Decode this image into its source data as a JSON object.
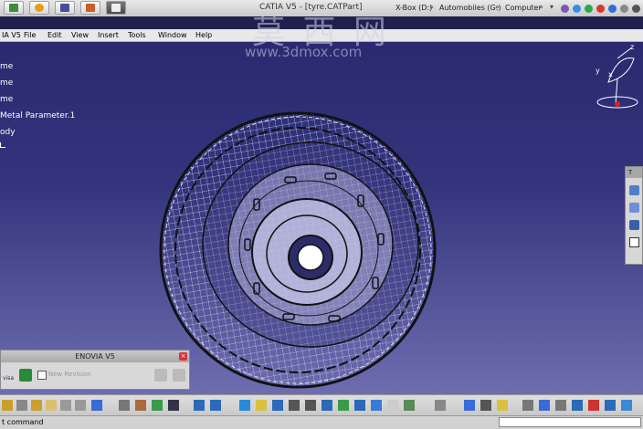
{
  "taskbar": {
    "title": "CATIA V5 - [tyre.CATPart]",
    "breadcrumb": [
      "X-Box (D:)",
      "Automobiles (G:)",
      "Computer"
    ]
  },
  "menu": {
    "app_label": "IA V5",
    "items": [
      "File",
      "Edit",
      "View",
      "Insert",
      "Tools",
      "Window",
      "Help"
    ]
  },
  "tree": {
    "items": [
      "me",
      "me",
      "me",
      "Metal Parameter.1",
      "ody"
    ]
  },
  "compass": {
    "x_label": "x",
    "y_label": "y",
    "z_label": "z"
  },
  "watermark": {
    "main": "莫 西 网",
    "url": "www.3dmox.com"
  },
  "enovia": {
    "title": "ENOVIA V5",
    "visa_label": "visa",
    "field_label": "New Revision"
  },
  "right_toolbar": {
    "title": "T"
  },
  "status": {
    "text": "t command"
  },
  "colors": {
    "background": "#20205e",
    "wireframe": "#d8d8ee",
    "accent": "#0080ff"
  }
}
